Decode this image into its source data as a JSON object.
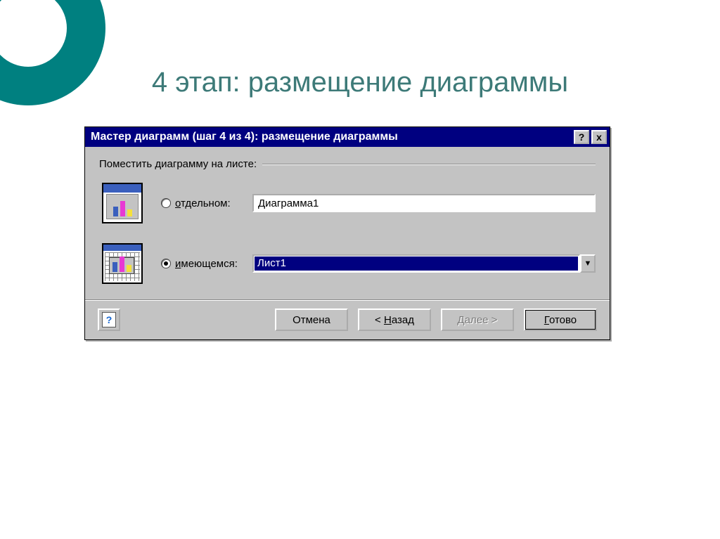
{
  "slide": {
    "title": "4 этап: размещение диаграммы"
  },
  "dialog": {
    "title": "Мастер диаграмм (шаг 4 из 4): размещение диаграммы",
    "help_icon": "?",
    "close_icon": "x",
    "group_label": "Поместить диаграмму на листе:",
    "options": {
      "separate": {
        "label_pre": "о",
        "label_rest": "тдельном:",
        "value": "Диаграмма1",
        "checked": false
      },
      "existing": {
        "label_pre": "и",
        "label_rest": "меющемся:",
        "value": "Лист1",
        "checked": true
      }
    },
    "buttons": {
      "cancel": "Отмена",
      "back": "< Назад",
      "back_u": "Н",
      "next": "Далее >",
      "next_u": "Д",
      "finish": "Готово",
      "finish_u": "Г"
    }
  }
}
